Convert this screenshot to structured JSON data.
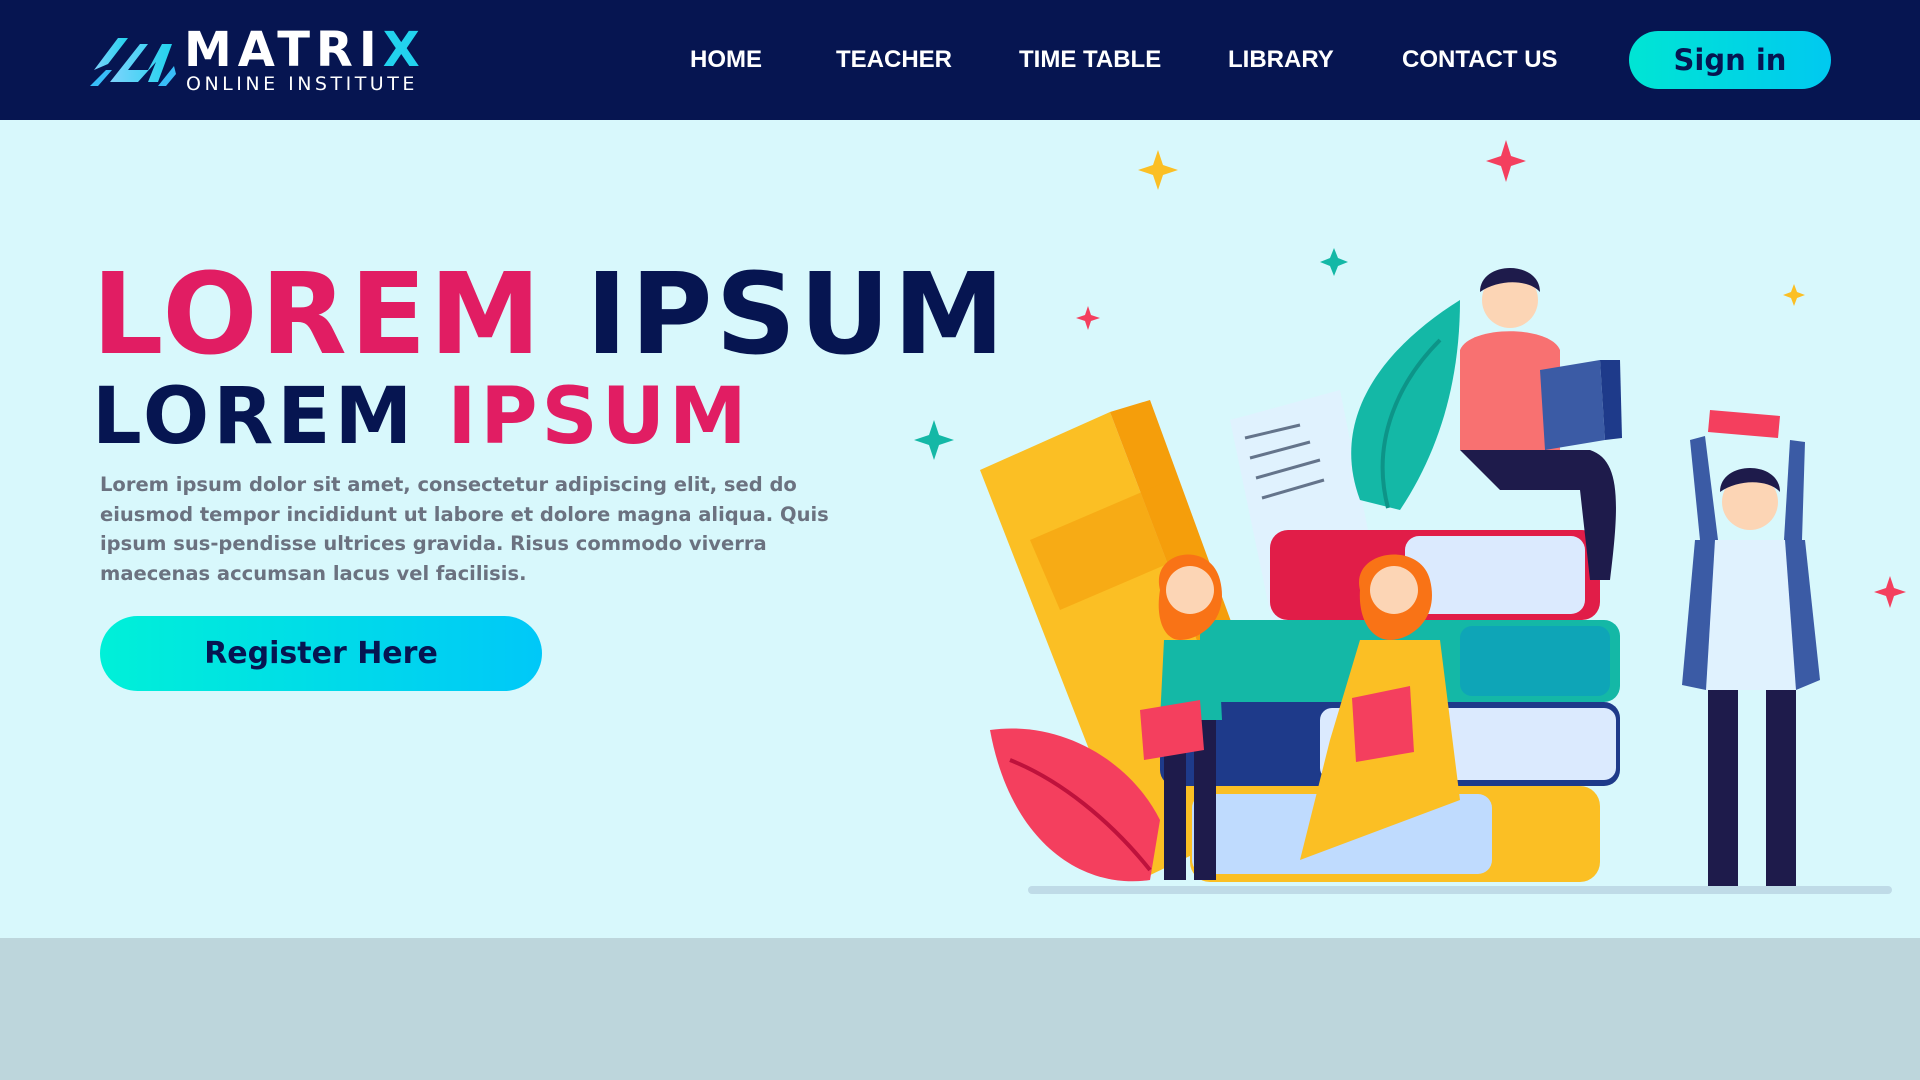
{
  "brand": {
    "name_main": "MATRI",
    "name_accent": "X",
    "tagline": "ONLINE INSTITUTE"
  },
  "nav": {
    "items": [
      {
        "label": "HOME"
      },
      {
        "label": "TEACHER"
      },
      {
        "label": "TIME TABLE"
      },
      {
        "label": "LIBRARY"
      },
      {
        "label": "CONTACT US"
      }
    ],
    "sign_in_label": "Sign in"
  },
  "hero": {
    "headline_1_part_a": "LOREM",
    "headline_1_part_b": "IPSUM",
    "headline_2_part_a": "LOREM",
    "headline_2_part_b": "IPSUM",
    "description": "Lorem ipsum dolor sit amet, consectetur adipiscing elit, sed do eiusmod tempor incididunt ut labore et dolore magna aliqua. Quis ipsum sus-pendisse ultrices gravida. Risus commodo viverra maecenas accumsan lacus vel facilisis.",
    "register_label": "Register Here"
  },
  "colors": {
    "header_bg": "#061551",
    "hero_bg": "#d8f8fc",
    "accent_pink": "#e11d63",
    "accent_cyan": "#00d8e8",
    "footer_bg": "#bdd6dc"
  },
  "icons": {
    "logo": "matrix-m-logo-icon",
    "illustration": "students-reading-books-illustration"
  }
}
